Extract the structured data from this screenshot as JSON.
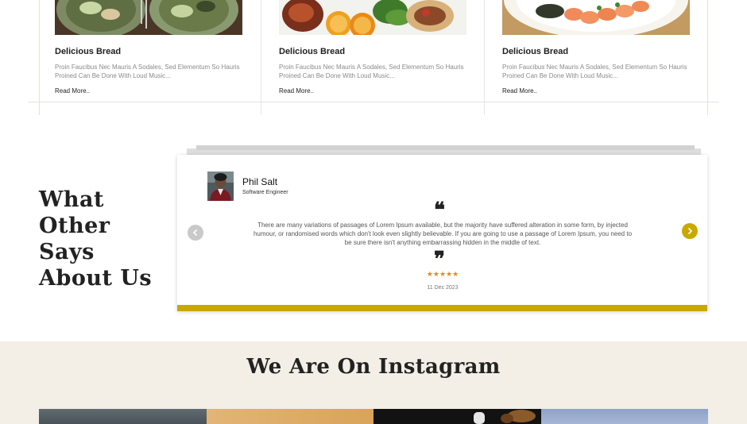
{
  "colors": {
    "accent": "#c9a900",
    "card_vline": "#f3e6a0",
    "card_vline_inner": "#e6e6e6",
    "insta_bg": "#f3eee6",
    "star": "#e08a1a",
    "arrow_prev": "#c9c9c9"
  },
  "cards": [
    {
      "title": "Delicious Bread",
      "description": "Proin Faucibus Nec Mauris A Sodales, Sed Elementum So Hauris Proined Can Be Done With Loud Music...",
      "read_more": "Read More.."
    },
    {
      "title": "Delicious Bread",
      "description": "Proin Faucibus Nec Mauris A Sodales, Sed Elementum So Hauris Proined Can Be Done With Loud Music...",
      "read_more": "Read More.."
    },
    {
      "title": "Delicious Bread",
      "description": "Proin Faucibus Nec Mauris A Sodales, Sed Elementum So Hauris Proined Can Be Done With Loud Music...",
      "read_more": "Read More.."
    }
  ],
  "testimonials": {
    "heading": [
      "What",
      "Other",
      "Says",
      "About Us"
    ],
    "name": "Phil Salt",
    "role": "Software Engineer",
    "text": "There are many variations of passages of Lorem Ipsum available, but the majority have suffered alteration in some form, by injected humour, or randomised words which don't look even slightly believable. If you are going to use a passage of Lorem Ipsum, you need to be sure there isn't anything embarrassing hidden in the middle of text.",
    "rating": 5,
    "stars": "★★★★★",
    "date": "11 Dec 2023",
    "open_quote": "❝",
    "close_quote": "❞",
    "prev_icon": "chevron-left-icon",
    "next_icon": "chevron-right-icon"
  },
  "instagram": {
    "title": "We Are On Instagram"
  }
}
